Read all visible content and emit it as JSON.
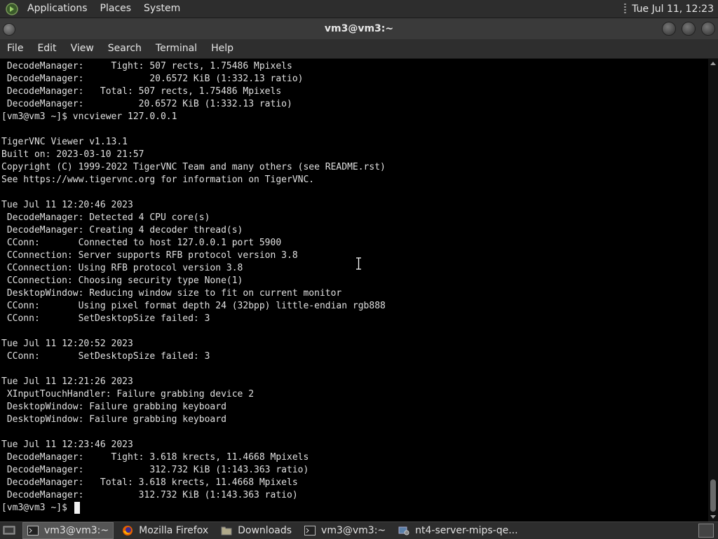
{
  "top_panel": {
    "menus": [
      "Applications",
      "Places",
      "System"
    ],
    "clock": "Tue Jul 11, 12:23"
  },
  "window": {
    "title": "vm3@vm3:~"
  },
  "menubar": {
    "items": [
      "File",
      "Edit",
      "View",
      "Search",
      "Terminal",
      "Help"
    ]
  },
  "terminal": {
    "text": " DecodeManager:     Tight: 507 rects, 1.75486 Mpixels\n DecodeManager:            20.6572 KiB (1:332.13 ratio)\n DecodeManager:   Total: 507 rects, 1.75486 Mpixels\n DecodeManager:          20.6572 KiB (1:332.13 ratio)\n[vm3@vm3 ~]$ vncviewer 127.0.0.1\n\nTigerVNC Viewer v1.13.1\nBuilt on: 2023-03-10 21:57\nCopyright (C) 1999-2022 TigerVNC Team and many others (see README.rst)\nSee https://www.tigervnc.org for information on TigerVNC.\n\nTue Jul 11 12:20:46 2023\n DecodeManager: Detected 4 CPU core(s)\n DecodeManager: Creating 4 decoder thread(s)\n CConn:       Connected to host 127.0.0.1 port 5900\n CConnection: Server supports RFB protocol version 3.8\n CConnection: Using RFB protocol version 3.8\n CConnection: Choosing security type None(1)\n DesktopWindow: Reducing window size to fit on current monitor\n CConn:       Using pixel format depth 24 (32bpp) little-endian rgb888\n CConn:       SetDesktopSize failed: 3\n\nTue Jul 11 12:20:52 2023\n CConn:       SetDesktopSize failed: 3\n\nTue Jul 11 12:21:26 2023\n XInputTouchHandler: Failure grabbing device 2\n DesktopWindow: Failure grabbing keyboard\n DesktopWindow: Failure grabbing keyboard\n\nTue Jul 11 12:23:46 2023\n DecodeManager:     Tight: 3.618 krects, 11.4668 Mpixels\n DecodeManager:            312.732 KiB (1:143.363 ratio)\n DecodeManager:   Total: 3.618 krects, 11.4668 Mpixels\n DecodeManager:          312.732 KiB (1:143.363 ratio)\n[vm3@vm3 ~]$ "
  },
  "taskbar": {
    "tasks": [
      {
        "label": "vm3@vm3:~",
        "icon": "terminal-icon",
        "active": true
      },
      {
        "label": "Mozilla Firefox",
        "icon": "firefox-icon",
        "active": false
      },
      {
        "label": "Downloads",
        "icon": "folder-icon",
        "active": false
      },
      {
        "label": "vm3@vm3:~",
        "icon": "terminal-icon",
        "active": false
      },
      {
        "label": "nt4-server-mips-qe...",
        "icon": "app-icon",
        "active": false
      }
    ]
  },
  "colors": {
    "panel_bg": "#2d2d2d",
    "terminal_bg": "#000000",
    "terminal_fg": "#e0e0e0"
  }
}
